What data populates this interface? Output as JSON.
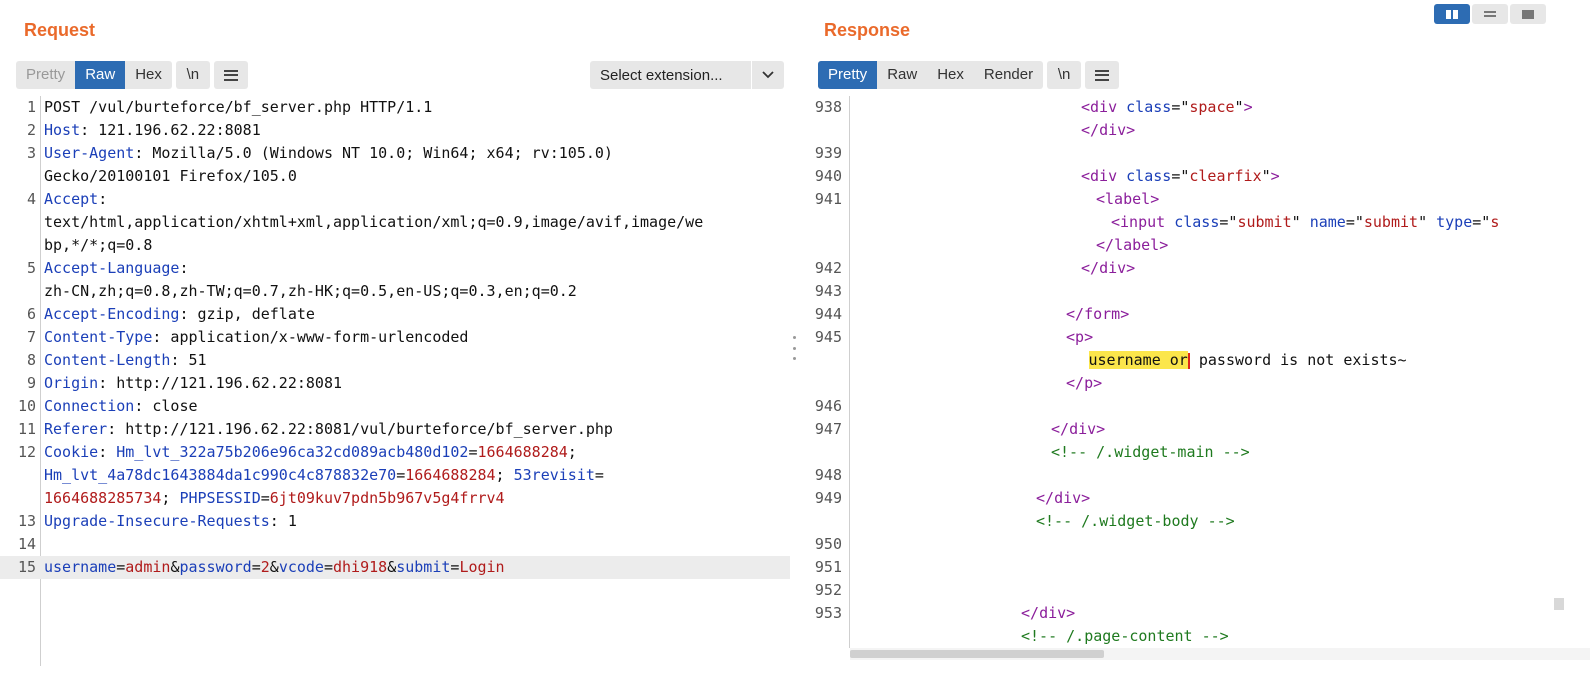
{
  "request": {
    "title": "Request",
    "tabs": [
      "Pretty",
      "Raw",
      "Hex"
    ],
    "newline_label": "\\n",
    "extension_label": "Select extension...",
    "lines": [
      {
        "n": "1",
        "parts": [
          {
            "t": "POST /vul/burteforce/bf_server.php HTTP/1.1"
          }
        ]
      },
      {
        "n": "2",
        "parts": [
          {
            "t": "Host",
            "c": "hk"
          },
          {
            "t": ": 121.196.62.22:8081"
          }
        ]
      },
      {
        "n": "3",
        "parts": [
          {
            "t": "User-Agent",
            "c": "hk"
          },
          {
            "t": ": Mozilla/5.0 (Windows NT 10.0; Win64; x64; rv:105.0)"
          }
        ]
      },
      {
        "n": "",
        "parts": [
          {
            "t": "Gecko/20100101 Firefox/105.0"
          }
        ]
      },
      {
        "n": "4",
        "parts": [
          {
            "t": "Accept",
            "c": "hk"
          },
          {
            "t": ":"
          }
        ]
      },
      {
        "n": "",
        "parts": [
          {
            "t": "text/html,application/xhtml+xml,application/xml;q=0.9,image/avif,image/we"
          }
        ]
      },
      {
        "n": "",
        "parts": [
          {
            "t": "bp,*/*;q=0.8"
          }
        ]
      },
      {
        "n": "5",
        "parts": [
          {
            "t": "Accept-Language",
            "c": "hk"
          },
          {
            "t": ":"
          }
        ]
      },
      {
        "n": "",
        "parts": [
          {
            "t": "zh-CN,zh;q=0.8,zh-TW;q=0.7,zh-HK;q=0.5,en-US;q=0.3,en;q=0.2"
          }
        ]
      },
      {
        "n": "6",
        "parts": [
          {
            "t": "Accept-Encoding",
            "c": "hk"
          },
          {
            "t": ": gzip, deflate"
          }
        ]
      },
      {
        "n": "7",
        "parts": [
          {
            "t": "Content-Type",
            "c": "hk"
          },
          {
            "t": ": application/x-www-form-urlencoded"
          }
        ]
      },
      {
        "n": "8",
        "parts": [
          {
            "t": "Content-Length",
            "c": "hk"
          },
          {
            "t": ": 51"
          }
        ]
      },
      {
        "n": "9",
        "parts": [
          {
            "t": "Origin",
            "c": "hk"
          },
          {
            "t": ": http://121.196.62.22:8081"
          }
        ]
      },
      {
        "n": "10",
        "parts": [
          {
            "t": "Connection",
            "c": "hk"
          },
          {
            "t": ": close"
          }
        ]
      },
      {
        "n": "11",
        "parts": [
          {
            "t": "Referer",
            "c": "hk"
          },
          {
            "t": ": http://121.196.62.22:8081/vul/burteforce/bf_server.php"
          }
        ]
      },
      {
        "n": "12",
        "parts": [
          {
            "t": "Cookie",
            "c": "hk"
          },
          {
            "t": ": "
          },
          {
            "t": "Hm_lvt_322a75b206e96ca32cd089acb480d102",
            "c": "hk"
          },
          {
            "t": "="
          },
          {
            "t": "1664688284",
            "c": "pv"
          },
          {
            "t": ";"
          }
        ]
      },
      {
        "n": "",
        "parts": [
          {
            "t": "Hm_lvt_4a78dc1643884da1c990c4c878832e70",
            "c": "hk"
          },
          {
            "t": "="
          },
          {
            "t": "1664688284",
            "c": "pv"
          },
          {
            "t": "; "
          },
          {
            "t": "53revisit",
            "c": "hk"
          },
          {
            "t": "="
          }
        ]
      },
      {
        "n": "",
        "parts": [
          {
            "t": "1664688285734",
            "c": "pv"
          },
          {
            "t": "; "
          },
          {
            "t": "PHPSESSID",
            "c": "hk"
          },
          {
            "t": "="
          },
          {
            "t": "6jt09kuv7pdn5b967v5g4frrv4",
            "c": "pv"
          }
        ]
      },
      {
        "n": "13",
        "parts": [
          {
            "t": "Upgrade-Insecure-Requests",
            "c": "hk"
          },
          {
            "t": ": 1"
          }
        ]
      },
      {
        "n": "14",
        "parts": []
      },
      {
        "n": "15",
        "current": true,
        "parts": [
          {
            "t": "username",
            "c": "hk"
          },
          {
            "t": "="
          },
          {
            "t": "admin",
            "c": "pv"
          },
          {
            "t": "&"
          },
          {
            "t": "password",
            "c": "hk"
          },
          {
            "t": "="
          },
          {
            "t": "2",
            "c": "pv"
          },
          {
            "t": "&"
          },
          {
            "t": "vcode",
            "c": "hk"
          },
          {
            "t": "="
          },
          {
            "t": "dhi918",
            "c": "pv"
          },
          {
            "t": "&"
          },
          {
            "t": "submit",
            "c": "hk"
          },
          {
            "t": "="
          },
          {
            "t": "Login",
            "c": "pv"
          }
        ]
      }
    ]
  },
  "response": {
    "title": "Response",
    "tabs": [
      "Pretty",
      "Raw",
      "Hex",
      "Render"
    ],
    "newline_label": "\\n",
    "lines": [
      {
        "n": "938",
        "ind": 30,
        "parts": [
          {
            "t": "<",
            "c": "tg"
          },
          {
            "t": "div",
            "c": "tg"
          },
          {
            "t": " "
          },
          {
            "t": "class",
            "c": "at"
          },
          {
            "t": "=\""
          },
          {
            "t": "space",
            "c": "av"
          },
          {
            "t": "\""
          },
          {
            "t": ">",
            "c": "tg"
          }
        ]
      },
      {
        "n": "",
        "ind": 30,
        "parts": [
          {
            "t": "</",
            "c": "tg"
          },
          {
            "t": "div",
            "c": "tg"
          },
          {
            "t": ">",
            "c": "tg"
          }
        ]
      },
      {
        "n": "939",
        "ind": 0,
        "parts": []
      },
      {
        "n": "940",
        "ind": 30,
        "parts": [
          {
            "t": "<",
            "c": "tg"
          },
          {
            "t": "div",
            "c": "tg"
          },
          {
            "t": " "
          },
          {
            "t": "class",
            "c": "at"
          },
          {
            "t": "=\""
          },
          {
            "t": "clearfix",
            "c": "av"
          },
          {
            "t": "\""
          },
          {
            "t": ">",
            "c": "tg"
          }
        ]
      },
      {
        "n": "941",
        "ind": 32,
        "parts": [
          {
            "t": "<",
            "c": "tg"
          },
          {
            "t": "label",
            "c": "tg"
          },
          {
            "t": ">",
            "c": "tg"
          }
        ]
      },
      {
        "n": "",
        "ind": 34,
        "parts": [
          {
            "t": "<",
            "c": "tg"
          },
          {
            "t": "input",
            "c": "tg"
          },
          {
            "t": " "
          },
          {
            "t": "class",
            "c": "at"
          },
          {
            "t": "=\""
          },
          {
            "t": "submit",
            "c": "av"
          },
          {
            "t": "\" "
          },
          {
            "t": "name",
            "c": "at"
          },
          {
            "t": "=\""
          },
          {
            "t": "submit",
            "c": "av"
          },
          {
            "t": "\" "
          },
          {
            "t": "type",
            "c": "at"
          },
          {
            "t": "=\""
          },
          {
            "t": "s",
            "c": "av"
          }
        ]
      },
      {
        "n": "",
        "ind": 32,
        "parts": [
          {
            "t": "</",
            "c": "tg"
          },
          {
            "t": "label",
            "c": "tg"
          },
          {
            "t": ">",
            "c": "tg"
          }
        ]
      },
      {
        "n": "942",
        "ind": 30,
        "parts": [
          {
            "t": "</",
            "c": "tg"
          },
          {
            "t": "div",
            "c": "tg"
          },
          {
            "t": ">",
            "c": "tg"
          }
        ]
      },
      {
        "n": "943",
        "ind": 0,
        "parts": []
      },
      {
        "n": "944",
        "ind": 28,
        "parts": [
          {
            "t": "</",
            "c": "tg"
          },
          {
            "t": "form",
            "c": "tg"
          },
          {
            "t": ">",
            "c": "tg"
          }
        ]
      },
      {
        "n": "945",
        "ind": 28,
        "parts": [
          {
            "t": "<",
            "c": "tg"
          },
          {
            "t": "p",
            "c": "tg"
          },
          {
            "t": ">",
            "c": "tg"
          }
        ]
      },
      {
        "n": "",
        "ind": 31,
        "parts": [
          {
            "t": "username or",
            "c": "hl"
          },
          {
            "caret": true
          },
          {
            "t": " password is not exists~"
          }
        ]
      },
      {
        "n": "",
        "ind": 28,
        "parts": [
          {
            "t": "</",
            "c": "tg"
          },
          {
            "t": "p",
            "c": "tg"
          },
          {
            "t": ">",
            "c": "tg"
          }
        ]
      },
      {
        "n": "946",
        "ind": 0,
        "parts": []
      },
      {
        "n": "947",
        "ind": 26,
        "parts": [
          {
            "t": "</",
            "c": "tg"
          },
          {
            "t": "div",
            "c": "tg"
          },
          {
            "t": ">",
            "c": "tg"
          }
        ]
      },
      {
        "n": "",
        "ind": 26,
        "parts": [
          {
            "t": "<!-- /.widget-main -->",
            "c": "cm"
          }
        ]
      },
      {
        "n": "948",
        "ind": 0,
        "parts": []
      },
      {
        "n": "949",
        "ind": 24,
        "parts": [
          {
            "t": "</",
            "c": "tg"
          },
          {
            "t": "div",
            "c": "tg"
          },
          {
            "t": ">",
            "c": "tg"
          }
        ]
      },
      {
        "n": "",
        "ind": 24,
        "parts": [
          {
            "t": "<!-- /.widget-body -->",
            "c": "cm"
          }
        ]
      },
      {
        "n": "950",
        "ind": 0,
        "parts": []
      },
      {
        "n": "951",
        "ind": 0,
        "parts": []
      },
      {
        "n": "952",
        "ind": 0,
        "parts": []
      },
      {
        "n": "953",
        "ind": 22,
        "parts": [
          {
            "t": "</",
            "c": "tg"
          },
          {
            "t": "div",
            "c": "tg"
          },
          {
            "t": ">",
            "c": "tg"
          }
        ]
      },
      {
        "n": "",
        "ind": 22,
        "parts": [
          {
            "t": "<!-- /.page-content -->",
            "c": "cm"
          }
        ]
      }
    ]
  },
  "colors": {
    "accent": "#2d6cb3",
    "title": "#ea6a2b",
    "key": "#1b3fb8",
    "value": "#b01b1b",
    "tag": "#8b1e9b",
    "comment": "#1f7a1f",
    "highlight": "#fbe64b"
  },
  "icons": {
    "menu": "hamburger-icon",
    "dropdown": "chevron-down-icon",
    "layout": [
      "side-by-side-icon",
      "stacked-icon",
      "tabs-icon"
    ]
  }
}
